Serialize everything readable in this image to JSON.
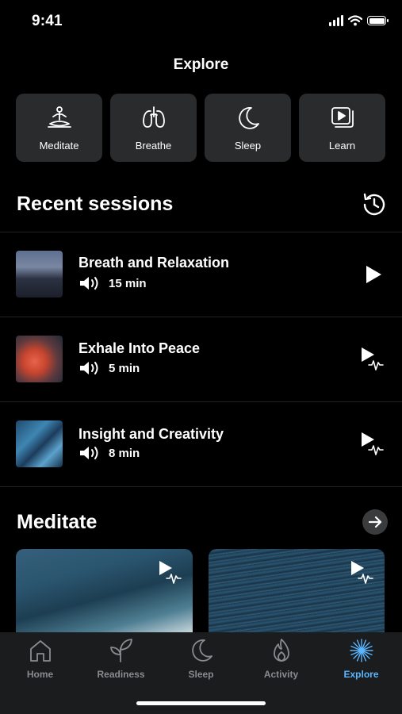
{
  "status_bar": {
    "time": "9:41"
  },
  "header": {
    "title": "Explore"
  },
  "categories": [
    {
      "label": "Meditate",
      "icon": "meditate-icon"
    },
    {
      "label": "Breathe",
      "icon": "lungs-icon"
    },
    {
      "label": "Sleep",
      "icon": "moon-icon"
    },
    {
      "label": "Learn",
      "icon": "video-library-icon"
    }
  ],
  "recent": {
    "title": "Recent sessions",
    "sessions": [
      {
        "title": "Breath and Relaxation",
        "duration": "15 min",
        "play_icon": "play-icon"
      },
      {
        "title": "Exhale Into Peace",
        "duration": "5 min",
        "play_icon": "play-biofeedback-icon"
      },
      {
        "title": "Insight and Creativity",
        "duration": "8 min",
        "play_icon": "play-biofeedback-icon"
      }
    ]
  },
  "meditate": {
    "title": "Meditate"
  },
  "tabs": [
    {
      "label": "Home",
      "active": false
    },
    {
      "label": "Readiness",
      "active": false
    },
    {
      "label": "Sleep",
      "active": false
    },
    {
      "label": "Activity",
      "active": false
    },
    {
      "label": "Explore",
      "active": true
    }
  ],
  "colors": {
    "background": "#000000",
    "card": "#2a2b2d",
    "accent": "#5ab7ff",
    "tab_inactive": "#8a8b8f"
  }
}
